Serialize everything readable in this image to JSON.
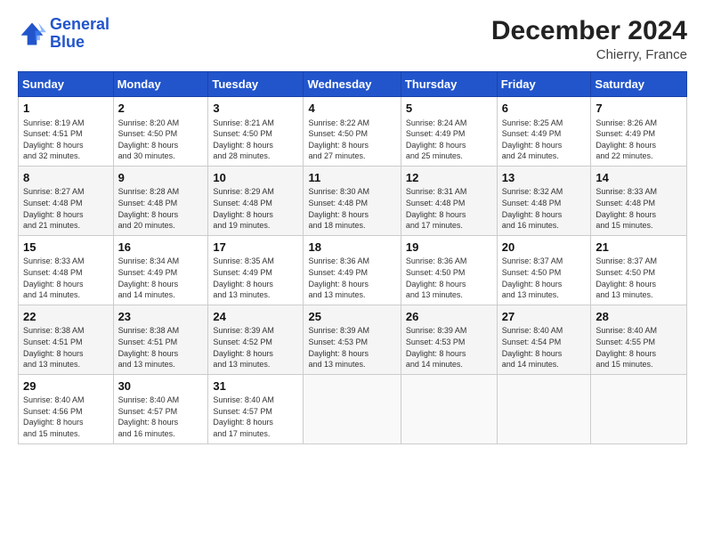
{
  "header": {
    "logo_line1": "General",
    "logo_line2": "Blue",
    "month": "December 2024",
    "location": "Chierry, France"
  },
  "weekdays": [
    "Sunday",
    "Monday",
    "Tuesday",
    "Wednesday",
    "Thursday",
    "Friday",
    "Saturday"
  ],
  "weeks": [
    [
      {
        "day": "1",
        "info": "Sunrise: 8:19 AM\nSunset: 4:51 PM\nDaylight: 8 hours\nand 32 minutes."
      },
      {
        "day": "2",
        "info": "Sunrise: 8:20 AM\nSunset: 4:50 PM\nDaylight: 8 hours\nand 30 minutes."
      },
      {
        "day": "3",
        "info": "Sunrise: 8:21 AM\nSunset: 4:50 PM\nDaylight: 8 hours\nand 28 minutes."
      },
      {
        "day": "4",
        "info": "Sunrise: 8:22 AM\nSunset: 4:50 PM\nDaylight: 8 hours\nand 27 minutes."
      },
      {
        "day": "5",
        "info": "Sunrise: 8:24 AM\nSunset: 4:49 PM\nDaylight: 8 hours\nand 25 minutes."
      },
      {
        "day": "6",
        "info": "Sunrise: 8:25 AM\nSunset: 4:49 PM\nDaylight: 8 hours\nand 24 minutes."
      },
      {
        "day": "7",
        "info": "Sunrise: 8:26 AM\nSunset: 4:49 PM\nDaylight: 8 hours\nand 22 minutes."
      }
    ],
    [
      {
        "day": "8",
        "info": "Sunrise: 8:27 AM\nSunset: 4:48 PM\nDaylight: 8 hours\nand 21 minutes."
      },
      {
        "day": "9",
        "info": "Sunrise: 8:28 AM\nSunset: 4:48 PM\nDaylight: 8 hours\nand 20 minutes."
      },
      {
        "day": "10",
        "info": "Sunrise: 8:29 AM\nSunset: 4:48 PM\nDaylight: 8 hours\nand 19 minutes."
      },
      {
        "day": "11",
        "info": "Sunrise: 8:30 AM\nSunset: 4:48 PM\nDaylight: 8 hours\nand 18 minutes."
      },
      {
        "day": "12",
        "info": "Sunrise: 8:31 AM\nSunset: 4:48 PM\nDaylight: 8 hours\nand 17 minutes."
      },
      {
        "day": "13",
        "info": "Sunrise: 8:32 AM\nSunset: 4:48 PM\nDaylight: 8 hours\nand 16 minutes."
      },
      {
        "day": "14",
        "info": "Sunrise: 8:33 AM\nSunset: 4:48 PM\nDaylight: 8 hours\nand 15 minutes."
      }
    ],
    [
      {
        "day": "15",
        "info": "Sunrise: 8:33 AM\nSunset: 4:48 PM\nDaylight: 8 hours\nand 14 minutes."
      },
      {
        "day": "16",
        "info": "Sunrise: 8:34 AM\nSunset: 4:49 PM\nDaylight: 8 hours\nand 14 minutes."
      },
      {
        "day": "17",
        "info": "Sunrise: 8:35 AM\nSunset: 4:49 PM\nDaylight: 8 hours\nand 13 minutes."
      },
      {
        "day": "18",
        "info": "Sunrise: 8:36 AM\nSunset: 4:49 PM\nDaylight: 8 hours\nand 13 minutes."
      },
      {
        "day": "19",
        "info": "Sunrise: 8:36 AM\nSunset: 4:50 PM\nDaylight: 8 hours\nand 13 minutes."
      },
      {
        "day": "20",
        "info": "Sunrise: 8:37 AM\nSunset: 4:50 PM\nDaylight: 8 hours\nand 13 minutes."
      },
      {
        "day": "21",
        "info": "Sunrise: 8:37 AM\nSunset: 4:50 PM\nDaylight: 8 hours\nand 13 minutes."
      }
    ],
    [
      {
        "day": "22",
        "info": "Sunrise: 8:38 AM\nSunset: 4:51 PM\nDaylight: 8 hours\nand 13 minutes."
      },
      {
        "day": "23",
        "info": "Sunrise: 8:38 AM\nSunset: 4:51 PM\nDaylight: 8 hours\nand 13 minutes."
      },
      {
        "day": "24",
        "info": "Sunrise: 8:39 AM\nSunset: 4:52 PM\nDaylight: 8 hours\nand 13 minutes."
      },
      {
        "day": "25",
        "info": "Sunrise: 8:39 AM\nSunset: 4:53 PM\nDaylight: 8 hours\nand 13 minutes."
      },
      {
        "day": "26",
        "info": "Sunrise: 8:39 AM\nSunset: 4:53 PM\nDaylight: 8 hours\nand 14 minutes."
      },
      {
        "day": "27",
        "info": "Sunrise: 8:40 AM\nSunset: 4:54 PM\nDaylight: 8 hours\nand 14 minutes."
      },
      {
        "day": "28",
        "info": "Sunrise: 8:40 AM\nSunset: 4:55 PM\nDaylight: 8 hours\nand 15 minutes."
      }
    ],
    [
      {
        "day": "29",
        "info": "Sunrise: 8:40 AM\nSunset: 4:56 PM\nDaylight: 8 hours\nand 15 minutes."
      },
      {
        "day": "30",
        "info": "Sunrise: 8:40 AM\nSunset: 4:57 PM\nDaylight: 8 hours\nand 16 minutes."
      },
      {
        "day": "31",
        "info": "Sunrise: 8:40 AM\nSunset: 4:57 PM\nDaylight: 8 hours\nand 17 minutes."
      },
      null,
      null,
      null,
      null
    ]
  ]
}
